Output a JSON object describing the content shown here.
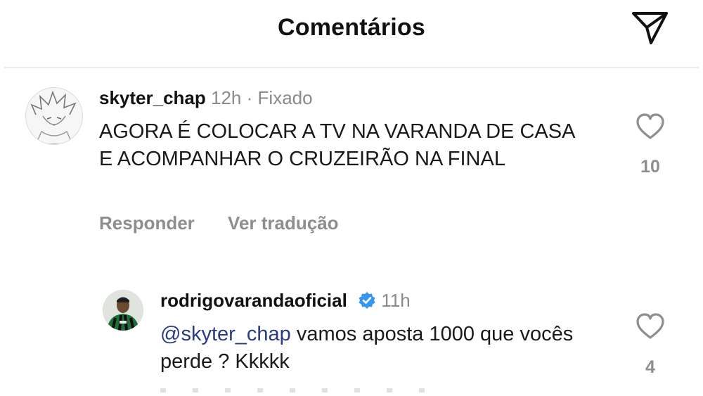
{
  "header": {
    "title": "Comentários",
    "share_icon": "send-icon"
  },
  "comments": [
    {
      "username": "skyter_chap",
      "time": "12h",
      "separator": "·",
      "pinned_label": "Fixado",
      "text": "AGORA É COLOCAR A TV NA VARANDA DE CASA E ACOMPANHAR O CRUZEIRÃO NA FINAL",
      "likes": "10",
      "reply_label": "Responder",
      "translate_label": "Ver tradução",
      "avatar_icon": "sketch-avatar-icon"
    },
    {
      "username": "rodrigovarandaoficial",
      "verified": true,
      "time": "11h",
      "mention": "@skyter_chap",
      "text": " vamos aposta 1000 que vocês perde ? Kkkkk",
      "likes": "4",
      "avatar_icon": "player-avatar-icon"
    }
  ],
  "colors": {
    "mention": "#2b3a86",
    "verified": "#3797f0",
    "muted": "#8e8e8e"
  }
}
